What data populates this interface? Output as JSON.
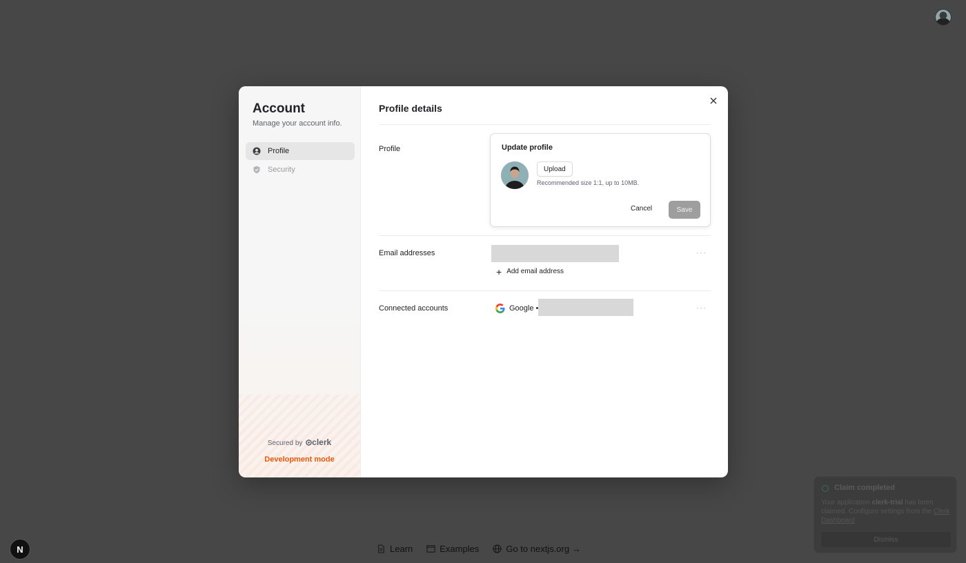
{
  "account": {
    "title": "Account",
    "subtitle": "Manage your account info.",
    "nav": [
      {
        "label": "Profile",
        "icon": "user-circle-icon"
      },
      {
        "label": "Security",
        "icon": "shield-icon"
      }
    ],
    "secured_by": "Secured by",
    "brand": "clerk",
    "dev_mode": "Development mode"
  },
  "profile": {
    "title": "Profile details",
    "profile_label": "Profile",
    "update": {
      "title": "Update profile",
      "upload": "Upload",
      "hint": "Recommended size 1:1, up to 10MB.",
      "cancel": "Cancel",
      "save": "Save"
    },
    "email_label": "Email addresses",
    "add_email": "Add email address",
    "connected_label": "Connected accounts",
    "google": "Google •",
    "more": "···"
  },
  "footer": {
    "learn": "Learn",
    "examples": "Examples",
    "nextjs": "Go to nextjs.org →"
  },
  "nextjs_badge": "N",
  "toast": {
    "title": "Claim completed",
    "body_prefix": "Your application ",
    "app_name": "clerk-trial",
    "body_suffix": " has been claimed. Configure settings from the ",
    "link": "Clerk Dashboard",
    "dismiss": "Dismiss"
  },
  "colors": {
    "backdrop": "#474747",
    "accent_dev": "#ea580c",
    "save_disabled": "#9e9e9e"
  }
}
